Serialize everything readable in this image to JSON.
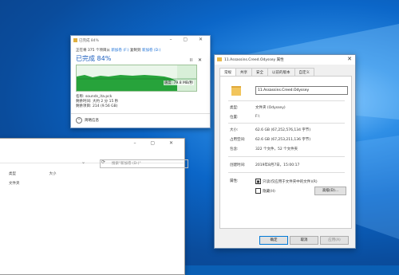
{
  "copy_dialog": {
    "title": "已完成 84%",
    "line1_prefix": "正在将 375 个项目从",
    "line1_source": "新加卷 (F:)",
    "line1_mid": "复制到",
    "line1_dest": "新加卷 (D:)",
    "percent_text": "已完成 84%",
    "speed": "速度: 79.8 MB/秒",
    "name_line": "名称: sounds_ita.pck",
    "time_line": "剩余时间: 大约 2 分 15 秒",
    "remaining_line": "剩余项目: 214 (9.56 GB)",
    "less_info": "简略信息",
    "progress": 0.84
  },
  "explorer": {
    "search_placeholder": "搜索\"新加卷 (D:)\"",
    "col_type": "类型",
    "col_size": "大小",
    "row_type": "文件夹"
  },
  "properties": {
    "title": "11.Assassins.Creed.Odyssey 属性",
    "tabs": [
      "常规",
      "共享",
      "安全",
      "以前的版本",
      "自定义"
    ],
    "folder_name": "11.Assassins.Creed.Odyssey",
    "type_label": "类型:",
    "type_value": "文件夹 (Odyssey)",
    "location_label": "位置:",
    "location_value": "F:\\",
    "size_label": "大小:",
    "size_value": "62.6 GB (67,252,576,134 字节)",
    "disk_size_label": "占用空间:",
    "disk_size_value": "62.6 GB (67,253,211,136 字节)",
    "contains_label": "包含:",
    "contains_value": "322 个文件，52 个文件夹",
    "created_label": "创建时间:",
    "created_value": "2019年8月7日，15:00:17",
    "attr_label": "属性:",
    "readonly_label": "只读(仅应用于文件夹中的文件)(R)",
    "hidden_label": "隐藏(H)",
    "advanced_button": "高级(D)...",
    "ok_button": "确定",
    "cancel_button": "取消",
    "apply_button": "应用(A)"
  }
}
